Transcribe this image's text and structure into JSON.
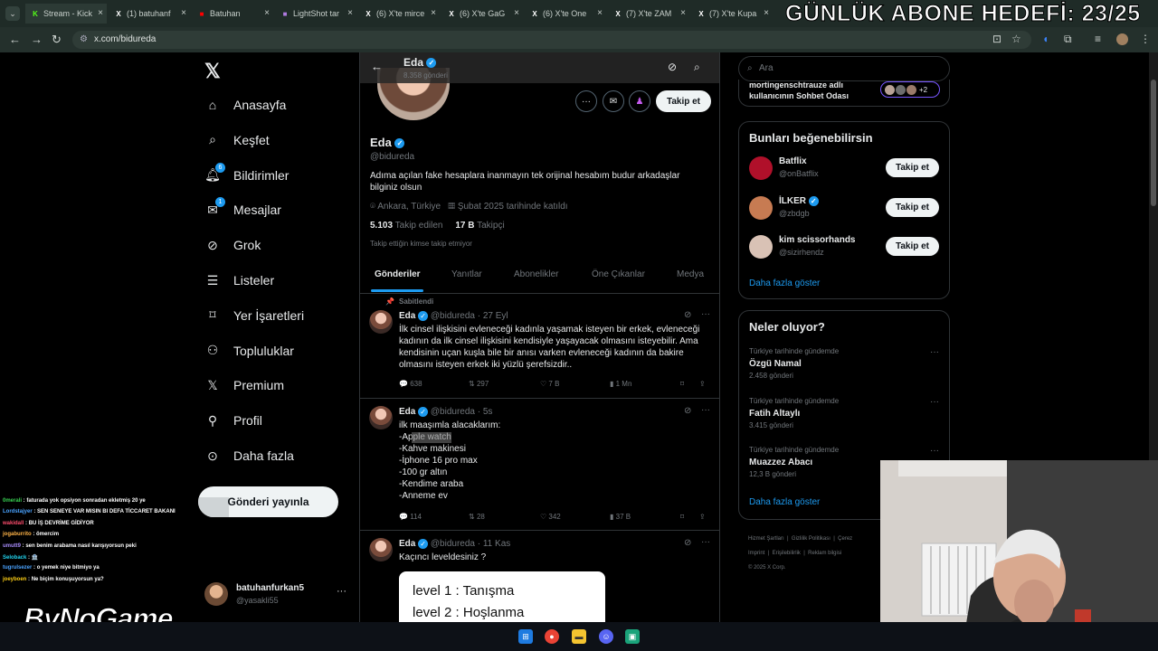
{
  "overlay": {
    "stream_title": "GÜNLÜK ABONE HEDEFİ: 23/25",
    "logo": "ByNoGame"
  },
  "browser": {
    "tabs": [
      {
        "label": "Stream - Kick",
        "icon": "kick-icon",
        "color": "#53fc18"
      },
      {
        "label": "(1) batuhanf",
        "icon": "x-icon",
        "color": "#ffffff"
      },
      {
        "label": "Batuhan",
        "icon": "youtube-icon",
        "color": "#ff0000"
      },
      {
        "label": "LightShot tar",
        "icon": "lightshot-icon",
        "color": "#b07ae0"
      },
      {
        "label": "(6) X'te mirce",
        "icon": "x-icon",
        "color": "#ffffff"
      },
      {
        "label": "(6) X'te GaG",
        "icon": "x-icon",
        "color": "#ffffff"
      },
      {
        "label": "(6) X'te One",
        "icon": "x-icon",
        "color": "#ffffff"
      },
      {
        "label": "(7) X'te ZAM",
        "icon": "x-icon",
        "color": "#ffffff"
      },
      {
        "label": "(7) X'te Kupa",
        "icon": "x-icon",
        "color": "#ffffff"
      }
    ],
    "url": "x.com/bidureda"
  },
  "nav": {
    "items": [
      {
        "label": "Anasayfa",
        "icon": "home-icon"
      },
      {
        "label": "Keşfet",
        "icon": "search-icon"
      },
      {
        "label": "Bildirimler",
        "icon": "bell-icon",
        "badge": "6"
      },
      {
        "label": "Mesajlar",
        "icon": "mail-icon",
        "badge": "1"
      },
      {
        "label": "Grok",
        "icon": "grok-icon"
      },
      {
        "label": "Listeler",
        "icon": "list-icon"
      },
      {
        "label": "Yer İşaretleri",
        "icon": "bookmark-icon"
      },
      {
        "label": "Topluluklar",
        "icon": "people-icon"
      },
      {
        "label": "Premium",
        "icon": "x-logo-icon"
      },
      {
        "label": "Profil",
        "icon": "person-icon"
      },
      {
        "label": "Daha fazla",
        "icon": "more-circle-icon"
      }
    ],
    "post_button": "Gönderi yayınla",
    "account": {
      "name": "batuhanfurkan5",
      "handle": "@yasakli55"
    }
  },
  "profile": {
    "header_name": "Eda",
    "header_posts": "8.358 gönderi",
    "name": "Eda",
    "handle": "@bidureda",
    "bio": "Adıma açılan fake hesaplara inanmayın tek orijinal hesabım budur arkadaşlar bilginiz olsun",
    "location": "Ankara, Türkiye",
    "joined": "Şubat 2025 tarihinde katıldı",
    "following_count": "5.103",
    "following_label": "Takip edilen",
    "followers_count": "17 B",
    "followers_label": "Takipçi",
    "mutuals": "Takip ettiğin kimse takip etmiyor",
    "follow_button": "Takip et",
    "tabs": [
      "Gönderiler",
      "Yanıtlar",
      "Abonelikler",
      "Öne Çıkanlar",
      "Medya"
    ]
  },
  "tweets": [
    {
      "pinned": "Sabitlendi",
      "name": "Eda",
      "meta": "@bidureda · 27 Eyl",
      "text": "İlk cinsel ilişkisini evleneceği kadınla yaşamak isteyen bir erkek, evleneceği kadının da ilk cinsel ilişkisini kendisiyle yaşayacak olmasını isteyebilir.  Ama kendisinin uçan kuşla bile bir anısı varken evleneceği kadının da bakire olmasını isteyen erkek iki yüzlü şerefsizdir..",
      "replies": "638",
      "reposts": "297",
      "likes": "7 B",
      "views": "1 Mn"
    },
    {
      "name": "Eda",
      "meta": "@bidureda · 5s",
      "text": "ilk maaşımla alacaklarım:\n-Apple watch\n-Kahve makinesi\n-İphone 16 pro max\n-100 gr altın\n-Kendime araba\n-Anneme ev",
      "replies": "114",
      "reposts": "28",
      "likes": "342",
      "views": "37 B"
    },
    {
      "name": "Eda",
      "meta": "@bidureda · 11 Kas",
      "text": "Kaçıncı leveldesiniz ?",
      "image_lines": [
        "level 1 : Tanışma",
        "level 2 : Hoşlanma"
      ]
    }
  ],
  "right": {
    "search_placeholder": "Ara",
    "chat_room": "mortingenschtrauze adlı kullanıcının Sohbet Odası",
    "chat_more": "+2",
    "suggestions_title": "Bunları beğenebilirsin",
    "suggestions": [
      {
        "name": "Batflix",
        "handle": "@onBatflix",
        "button": "Takip et",
        "color": "#b0102a"
      },
      {
        "name": "İLKER",
        "handle": "@zbdgb",
        "button": "Takip et",
        "color": "#c77b52",
        "verified": true
      },
      {
        "name": "kim scissorhands",
        "handle": "@sizirhendz",
        "button": "Takip et",
        "color": "#d9c2b5"
      }
    ],
    "show_more": "Daha fazla göster",
    "trends_title": "Neler oluyor?",
    "trends": [
      {
        "context": "Türkiye tarihinde gündemde",
        "name": "Özgü Namal",
        "count": "2.458 gönderi"
      },
      {
        "context": "Türkiye tarihinde gündemde",
        "name": "Fatih Altaylı",
        "count": "3.415 gönderi"
      },
      {
        "context": "Türkiye tarihinde gündemde",
        "name": "Muazzez Abacı",
        "count": "12,3 B gönderi"
      }
    ],
    "trends_more": "Daha fazla göster",
    "footer": [
      "Hizmet Şartları",
      "Gizlilik Politikası",
      "Çerez",
      "Imprint",
      "Erişilebilirlik",
      "Reklam bilgisi",
      "© 2025 X Corp."
    ]
  },
  "chat": [
    {
      "user": "0merali",
      "msg": "faturada yok opsiyon sonradan ekletmiş 20 ye",
      "color": "#39d353"
    },
    {
      "user": "Lordstajyer",
      "msg": "SEN SENEYE VAR MISIN BI DEFA TİCCARET BAKANI",
      "color": "#4aa3ff"
    },
    {
      "user": "wakidall",
      "msg": "BU İŞ DEVRİME GİDİYOR",
      "color": "#ff4d6d"
    },
    {
      "user": "jogaburrito",
      "msg": "ömercim",
      "color": "#ffb347"
    },
    {
      "user": "umutt9",
      "msg": "sen benim arabama nasıl karışıyorsun peki",
      "color": "#a78bfa"
    },
    {
      "user": "Seloback",
      "msg": "🏦",
      "color": "#22d3ee"
    },
    {
      "user": "tugrulsezer",
      "msg": "o yemek niye bitmiyo ya",
      "color": "#4aa3ff"
    },
    {
      "user": "joeyboen",
      "msg": "Ne biçim konuşuyorsun ya?",
      "color": "#facc15"
    }
  ]
}
